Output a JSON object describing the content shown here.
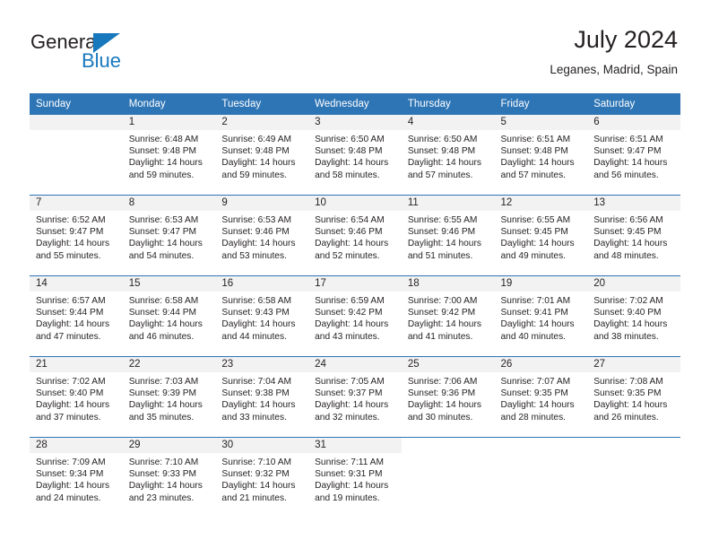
{
  "brand": {
    "name_part1": "General",
    "name_part2": "Blue"
  },
  "header": {
    "title": "July 2024",
    "subtitle": "Leganes, Madrid, Spain"
  },
  "calendar": {
    "weekday_headers": [
      "Sunday",
      "Monday",
      "Tuesday",
      "Wednesday",
      "Thursday",
      "Friday",
      "Saturday"
    ],
    "colors": {
      "header_background": "#2e75b6",
      "header_text": "#ffffff",
      "daynum_background": "#f2f2f2",
      "grid_line": "#2e75b6",
      "body_text": "#231f20",
      "brand_blue": "#1878be"
    },
    "weeks": [
      [
        {
          "day": "",
          "sunrise": "",
          "sunset": "",
          "daylight_line1": "",
          "daylight_line2": ""
        },
        {
          "day": "1",
          "sunrise": "Sunrise: 6:48 AM",
          "sunset": "Sunset: 9:48 PM",
          "daylight_line1": "Daylight: 14 hours",
          "daylight_line2": "and 59 minutes."
        },
        {
          "day": "2",
          "sunrise": "Sunrise: 6:49 AM",
          "sunset": "Sunset: 9:48 PM",
          "daylight_line1": "Daylight: 14 hours",
          "daylight_line2": "and 59 minutes."
        },
        {
          "day": "3",
          "sunrise": "Sunrise: 6:50 AM",
          "sunset": "Sunset: 9:48 PM",
          "daylight_line1": "Daylight: 14 hours",
          "daylight_line2": "and 58 minutes."
        },
        {
          "day": "4",
          "sunrise": "Sunrise: 6:50 AM",
          "sunset": "Sunset: 9:48 PM",
          "daylight_line1": "Daylight: 14 hours",
          "daylight_line2": "and 57 minutes."
        },
        {
          "day": "5",
          "sunrise": "Sunrise: 6:51 AM",
          "sunset": "Sunset: 9:48 PM",
          "daylight_line1": "Daylight: 14 hours",
          "daylight_line2": "and 57 minutes."
        },
        {
          "day": "6",
          "sunrise": "Sunrise: 6:51 AM",
          "sunset": "Sunset: 9:47 PM",
          "daylight_line1": "Daylight: 14 hours",
          "daylight_line2": "and 56 minutes."
        }
      ],
      [
        {
          "day": "7",
          "sunrise": "Sunrise: 6:52 AM",
          "sunset": "Sunset: 9:47 PM",
          "daylight_line1": "Daylight: 14 hours",
          "daylight_line2": "and 55 minutes."
        },
        {
          "day": "8",
          "sunrise": "Sunrise: 6:53 AM",
          "sunset": "Sunset: 9:47 PM",
          "daylight_line1": "Daylight: 14 hours",
          "daylight_line2": "and 54 minutes."
        },
        {
          "day": "9",
          "sunrise": "Sunrise: 6:53 AM",
          "sunset": "Sunset: 9:46 PM",
          "daylight_line1": "Daylight: 14 hours",
          "daylight_line2": "and 53 minutes."
        },
        {
          "day": "10",
          "sunrise": "Sunrise: 6:54 AM",
          "sunset": "Sunset: 9:46 PM",
          "daylight_line1": "Daylight: 14 hours",
          "daylight_line2": "and 52 minutes."
        },
        {
          "day": "11",
          "sunrise": "Sunrise: 6:55 AM",
          "sunset": "Sunset: 9:46 PM",
          "daylight_line1": "Daylight: 14 hours",
          "daylight_line2": "and 51 minutes."
        },
        {
          "day": "12",
          "sunrise": "Sunrise: 6:55 AM",
          "sunset": "Sunset: 9:45 PM",
          "daylight_line1": "Daylight: 14 hours",
          "daylight_line2": "and 49 minutes."
        },
        {
          "day": "13",
          "sunrise": "Sunrise: 6:56 AM",
          "sunset": "Sunset: 9:45 PM",
          "daylight_line1": "Daylight: 14 hours",
          "daylight_line2": "and 48 minutes."
        }
      ],
      [
        {
          "day": "14",
          "sunrise": "Sunrise: 6:57 AM",
          "sunset": "Sunset: 9:44 PM",
          "daylight_line1": "Daylight: 14 hours",
          "daylight_line2": "and 47 minutes."
        },
        {
          "day": "15",
          "sunrise": "Sunrise: 6:58 AM",
          "sunset": "Sunset: 9:44 PM",
          "daylight_line1": "Daylight: 14 hours",
          "daylight_line2": "and 46 minutes."
        },
        {
          "day": "16",
          "sunrise": "Sunrise: 6:58 AM",
          "sunset": "Sunset: 9:43 PM",
          "daylight_line1": "Daylight: 14 hours",
          "daylight_line2": "and 44 minutes."
        },
        {
          "day": "17",
          "sunrise": "Sunrise: 6:59 AM",
          "sunset": "Sunset: 9:42 PM",
          "daylight_line1": "Daylight: 14 hours",
          "daylight_line2": "and 43 minutes."
        },
        {
          "day": "18",
          "sunrise": "Sunrise: 7:00 AM",
          "sunset": "Sunset: 9:42 PM",
          "daylight_line1": "Daylight: 14 hours",
          "daylight_line2": "and 41 minutes."
        },
        {
          "day": "19",
          "sunrise": "Sunrise: 7:01 AM",
          "sunset": "Sunset: 9:41 PM",
          "daylight_line1": "Daylight: 14 hours",
          "daylight_line2": "and 40 minutes."
        },
        {
          "day": "20",
          "sunrise": "Sunrise: 7:02 AM",
          "sunset": "Sunset: 9:40 PM",
          "daylight_line1": "Daylight: 14 hours",
          "daylight_line2": "and 38 minutes."
        }
      ],
      [
        {
          "day": "21",
          "sunrise": "Sunrise: 7:02 AM",
          "sunset": "Sunset: 9:40 PM",
          "daylight_line1": "Daylight: 14 hours",
          "daylight_line2": "and 37 minutes."
        },
        {
          "day": "22",
          "sunrise": "Sunrise: 7:03 AM",
          "sunset": "Sunset: 9:39 PM",
          "daylight_line1": "Daylight: 14 hours",
          "daylight_line2": "and 35 minutes."
        },
        {
          "day": "23",
          "sunrise": "Sunrise: 7:04 AM",
          "sunset": "Sunset: 9:38 PM",
          "daylight_line1": "Daylight: 14 hours",
          "daylight_line2": "and 33 minutes."
        },
        {
          "day": "24",
          "sunrise": "Sunrise: 7:05 AM",
          "sunset": "Sunset: 9:37 PM",
          "daylight_line1": "Daylight: 14 hours",
          "daylight_line2": "and 32 minutes."
        },
        {
          "day": "25",
          "sunrise": "Sunrise: 7:06 AM",
          "sunset": "Sunset: 9:36 PM",
          "daylight_line1": "Daylight: 14 hours",
          "daylight_line2": "and 30 minutes."
        },
        {
          "day": "26",
          "sunrise": "Sunrise: 7:07 AM",
          "sunset": "Sunset: 9:35 PM",
          "daylight_line1": "Daylight: 14 hours",
          "daylight_line2": "and 28 minutes."
        },
        {
          "day": "27",
          "sunrise": "Sunrise: 7:08 AM",
          "sunset": "Sunset: 9:35 PM",
          "daylight_line1": "Daylight: 14 hours",
          "daylight_line2": "and 26 minutes."
        }
      ],
      [
        {
          "day": "28",
          "sunrise": "Sunrise: 7:09 AM",
          "sunset": "Sunset: 9:34 PM",
          "daylight_line1": "Daylight: 14 hours",
          "daylight_line2": "and 24 minutes."
        },
        {
          "day": "29",
          "sunrise": "Sunrise: 7:10 AM",
          "sunset": "Sunset: 9:33 PM",
          "daylight_line1": "Daylight: 14 hours",
          "daylight_line2": "and 23 minutes."
        },
        {
          "day": "30",
          "sunrise": "Sunrise: 7:10 AM",
          "sunset": "Sunset: 9:32 PM",
          "daylight_line1": "Daylight: 14 hours",
          "daylight_line2": "and 21 minutes."
        },
        {
          "day": "31",
          "sunrise": "Sunrise: 7:11 AM",
          "sunset": "Sunset: 9:31 PM",
          "daylight_line1": "Daylight: 14 hours",
          "daylight_line2": "and 19 minutes."
        },
        {
          "day": "",
          "sunrise": "",
          "sunset": "",
          "daylight_line1": "",
          "daylight_line2": ""
        },
        {
          "day": "",
          "sunrise": "",
          "sunset": "",
          "daylight_line1": "",
          "daylight_line2": ""
        },
        {
          "day": "",
          "sunrise": "",
          "sunset": "",
          "daylight_line1": "",
          "daylight_line2": ""
        }
      ]
    ]
  }
}
